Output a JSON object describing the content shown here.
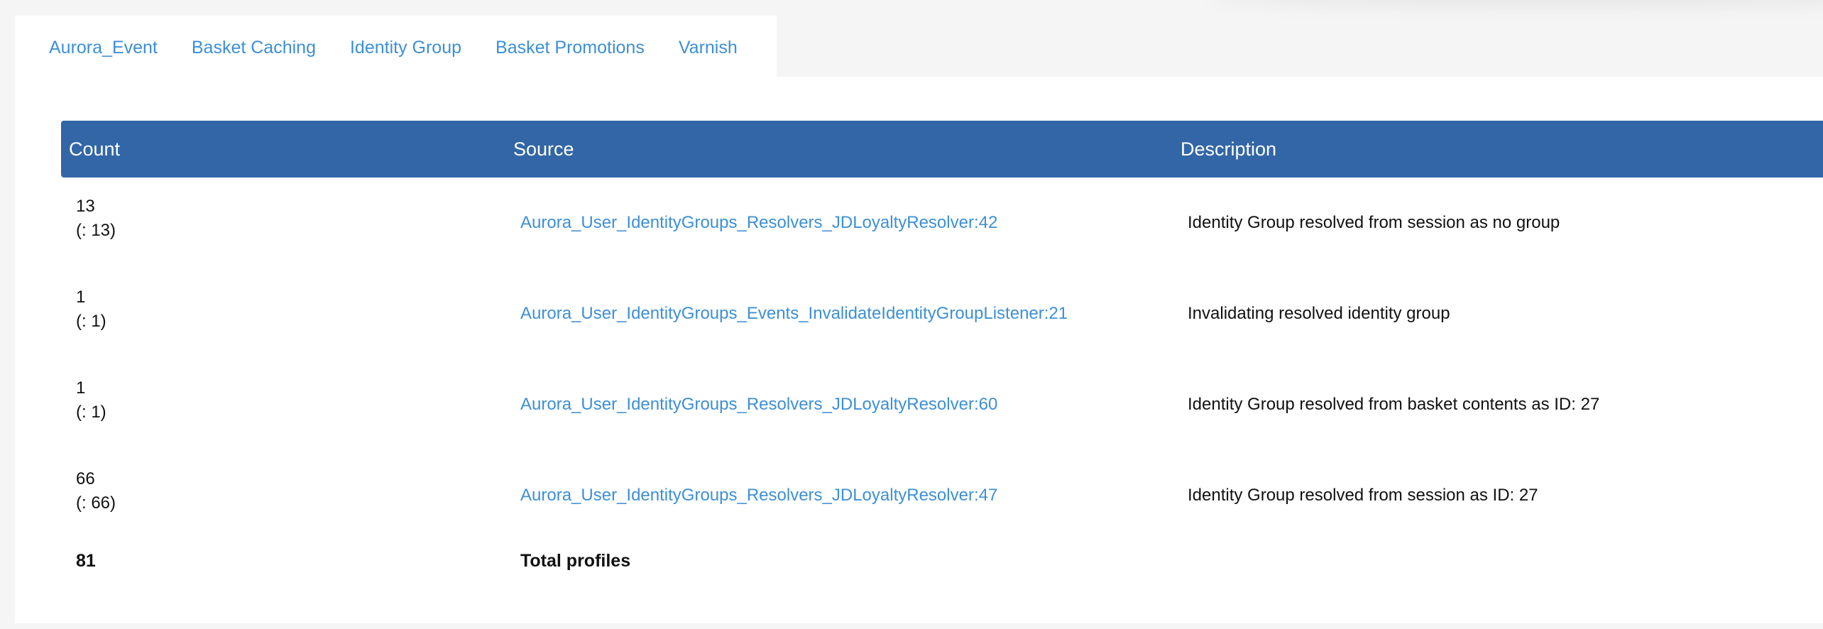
{
  "tabs": [
    {
      "label": "Aurora_Event"
    },
    {
      "label": "Basket Caching"
    },
    {
      "label": "Identity Group"
    },
    {
      "label": "Basket Promotions"
    },
    {
      "label": "Varnish"
    }
  ],
  "table": {
    "headers": {
      "count": "Count",
      "source": "Source",
      "description": "Description"
    },
    "rows": [
      {
        "count": "13",
        "count_sub": "(: 13)",
        "source": "Aurora_User_IdentityGroups_Resolvers_JDLoyaltyResolver:42",
        "description": "Identity Group resolved from session as no group"
      },
      {
        "count": "1",
        "count_sub": "(: 1)",
        "source": "Aurora_User_IdentityGroups_Events_InvalidateIdentityGroupListener:21",
        "description": "Invalidating resolved identity group"
      },
      {
        "count": "1",
        "count_sub": "(: 1)",
        "source": "Aurora_User_IdentityGroups_Resolvers_JDLoyaltyResolver:60",
        "description": "Identity Group resolved from basket contents as ID: 27"
      },
      {
        "count": "66",
        "count_sub": "(: 66)",
        "source": "Aurora_User_IdentityGroups_Resolvers_JDLoyaltyResolver:47",
        "description": "Identity Group resolved from session as ID: 27"
      }
    ],
    "total": {
      "count": "81",
      "label": "Total profiles"
    }
  },
  "colors": {
    "header_bg": "#3266a6",
    "link": "#3d8fd6",
    "page_bg": "#f5f5f5",
    "panel_bg": "#ffffff"
  }
}
